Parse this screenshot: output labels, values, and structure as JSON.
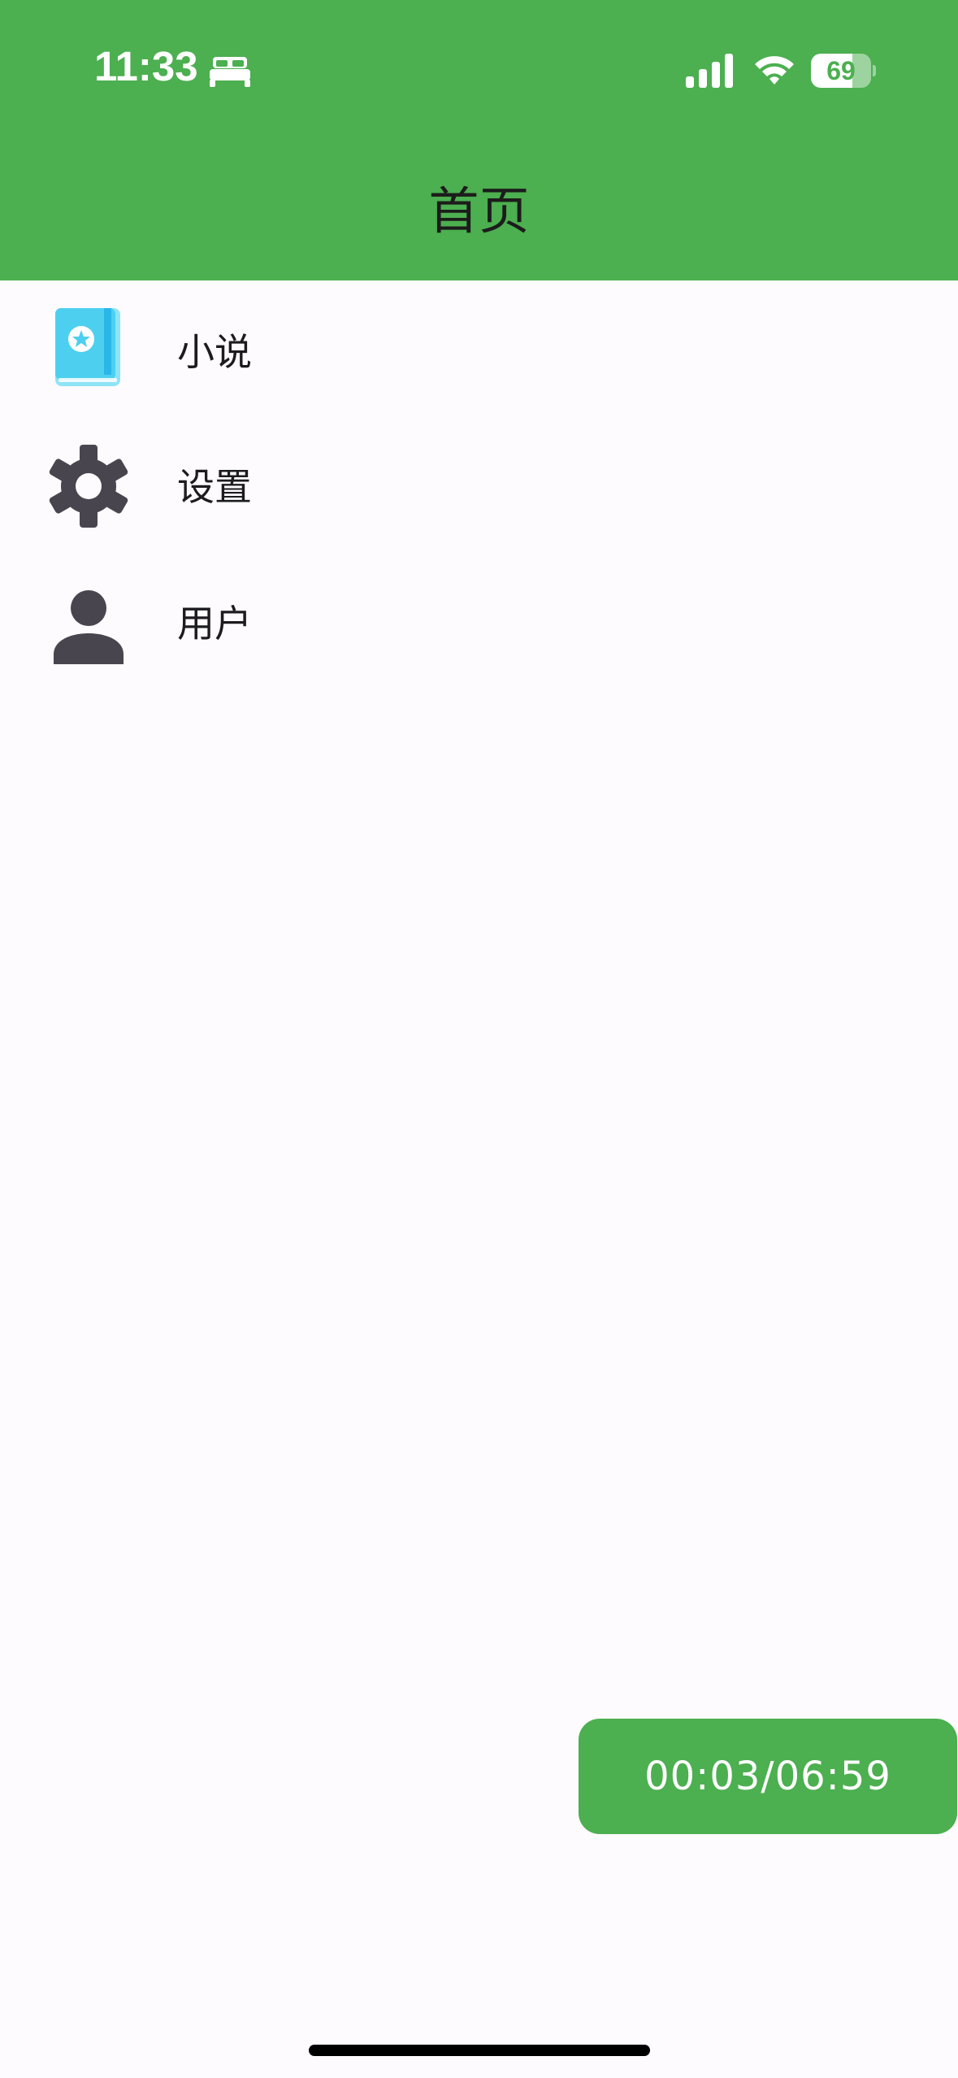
{
  "status_bar": {
    "time": "11:33",
    "battery_level": "69",
    "battery_fraction": 0.69,
    "icons": [
      "bed-icon",
      "signal-icon",
      "wifi-icon",
      "battery-icon"
    ]
  },
  "header": {
    "title": "首页",
    "color": "#4caf50"
  },
  "menu": {
    "items": [
      {
        "label": "小说",
        "icon": "book-icon"
      },
      {
        "label": "设置",
        "icon": "gear-icon"
      },
      {
        "label": "用户",
        "icon": "person-icon"
      }
    ]
  },
  "timer": {
    "text": "00:03/06:59"
  }
}
